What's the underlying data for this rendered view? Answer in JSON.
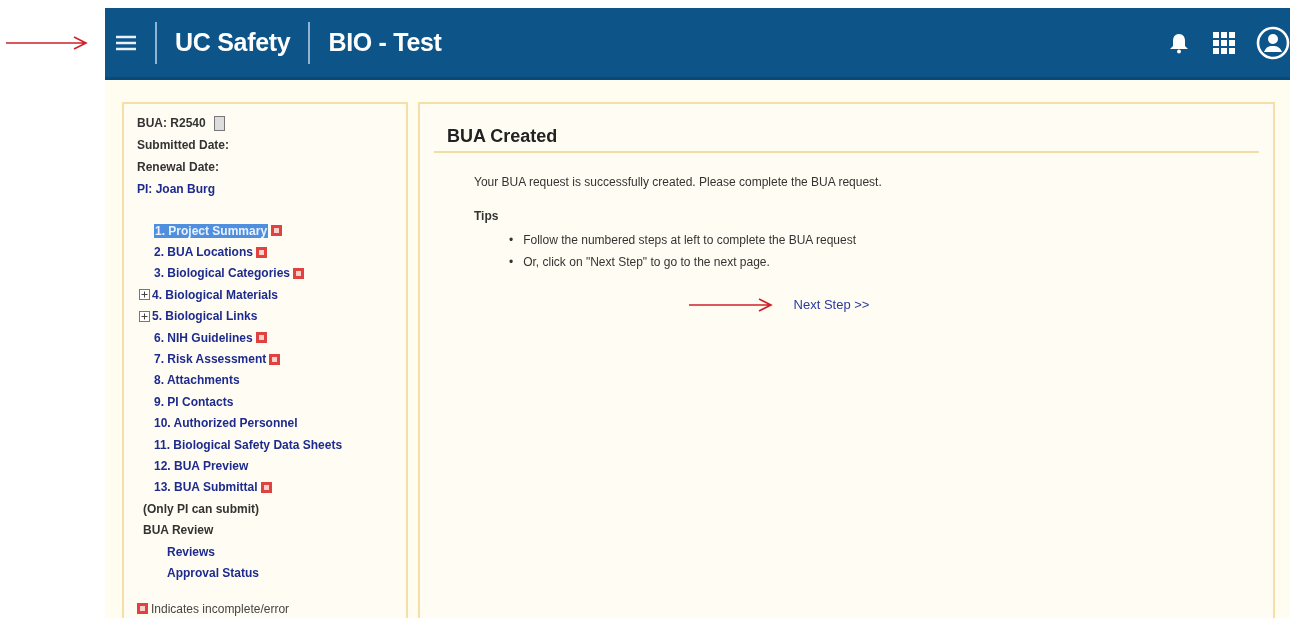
{
  "header": {
    "app_title": "UC Safety",
    "module_title": "BIO - Test"
  },
  "sidebar": {
    "info": [
      {
        "kind": "id",
        "text": "BUA: R2540"
      },
      {
        "kind": "label",
        "text": "Submitted Date:"
      },
      {
        "kind": "label",
        "text": "Renewal Date:"
      },
      {
        "kind": "link",
        "text": "PI: Joan Burg"
      }
    ],
    "steps": [
      {
        "kind": "step",
        "label": "1. Project Summary",
        "selected": true,
        "incomplete": true
      },
      {
        "kind": "step",
        "label": "2. BUA Locations",
        "selected": false,
        "incomplete": true
      },
      {
        "kind": "step",
        "label": "3. Biological Categories",
        "selected": false,
        "incomplete": true
      },
      {
        "kind": "group",
        "label": "4. Biological Materials",
        "selected": false,
        "incomplete": false,
        "expanded": false
      },
      {
        "kind": "group",
        "label": "5. Biological Links",
        "selected": false,
        "incomplete": false,
        "expanded": false
      },
      {
        "kind": "step",
        "label": "6. NIH Guidelines",
        "selected": false,
        "incomplete": true
      },
      {
        "kind": "step",
        "label": "7. Risk Assessment",
        "selected": false,
        "incomplete": true
      },
      {
        "kind": "step",
        "label": "8. Attachments",
        "selected": false,
        "incomplete": false
      },
      {
        "kind": "step",
        "label": "9. PI Contacts",
        "selected": false,
        "incomplete": false
      },
      {
        "kind": "step",
        "label": "10. Authorized Personnel",
        "selected": false,
        "incomplete": false
      },
      {
        "kind": "step",
        "label": "11. Biological Safety Data Sheets",
        "selected": false,
        "incomplete": false
      },
      {
        "kind": "step",
        "label": "12. BUA Preview",
        "selected": false,
        "incomplete": false
      },
      {
        "kind": "step",
        "label": "13. BUA Submittal",
        "selected": false,
        "incomplete": true
      }
    ],
    "note": "(Only PI can submit)",
    "review": {
      "title": "BUA Review",
      "items": [
        "Reviews",
        "Approval Status"
      ]
    },
    "legend": "Indicates incomplete/error"
  },
  "main": {
    "title": "BUA Created",
    "message": "Your BUA request is successfully created. Please complete the BUA request.",
    "tips_title": "Tips",
    "tips": [
      {
        "bullet": "•",
        "text": "Follow the numbered steps at left to complete the BUA request"
      },
      {
        "bullet": "•",
        "text": "Or, click on \"Next Step\" to go to the next page."
      }
    ],
    "next_link": "Next Step >>"
  }
}
